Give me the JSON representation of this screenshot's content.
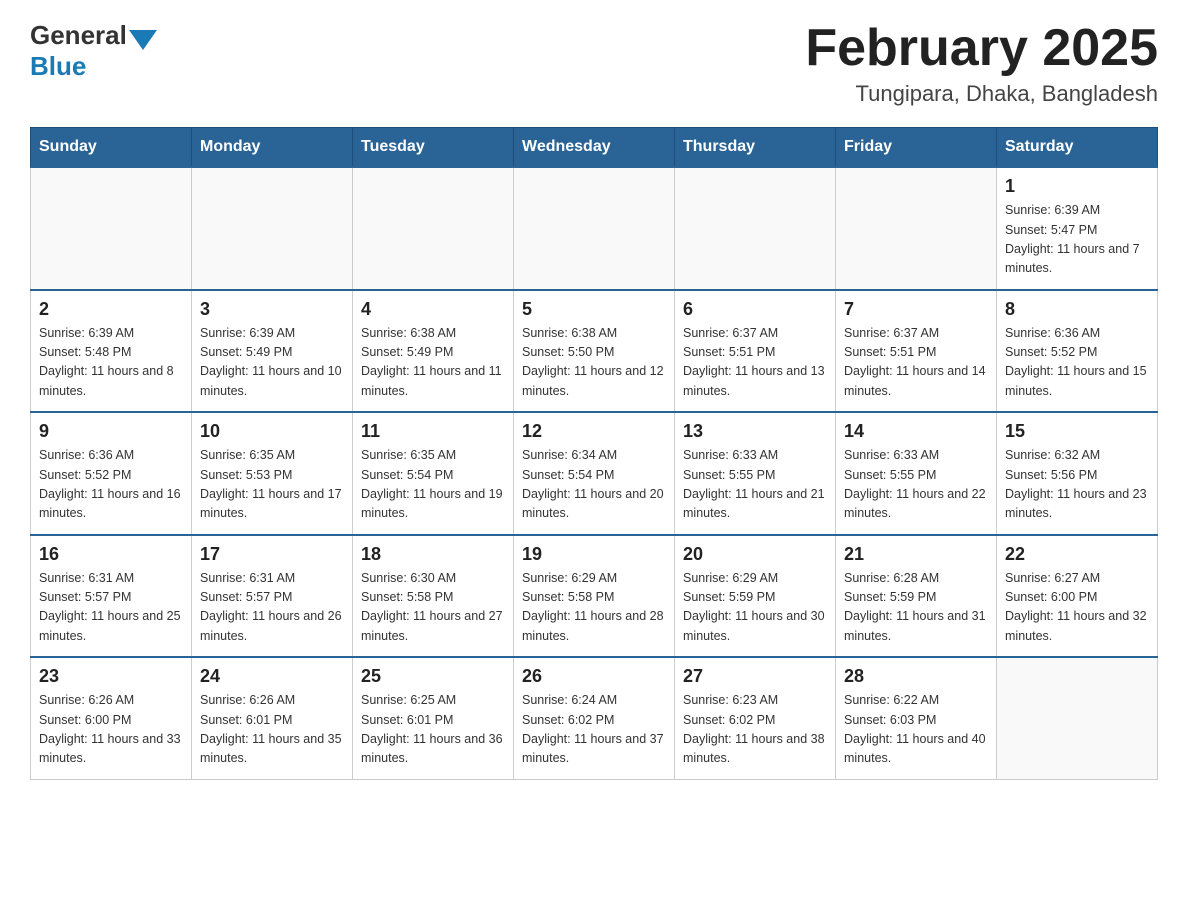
{
  "header": {
    "logo_general": "General",
    "logo_blue": "Blue",
    "title": "February 2025",
    "location": "Tungipara, Dhaka, Bangladesh"
  },
  "weekdays": [
    "Sunday",
    "Monday",
    "Tuesday",
    "Wednesday",
    "Thursday",
    "Friday",
    "Saturday"
  ],
  "weeks": [
    [
      {
        "day": "",
        "info": ""
      },
      {
        "day": "",
        "info": ""
      },
      {
        "day": "",
        "info": ""
      },
      {
        "day": "",
        "info": ""
      },
      {
        "day": "",
        "info": ""
      },
      {
        "day": "",
        "info": ""
      },
      {
        "day": "1",
        "info": "Sunrise: 6:39 AM\nSunset: 5:47 PM\nDaylight: 11 hours and 7 minutes."
      }
    ],
    [
      {
        "day": "2",
        "info": "Sunrise: 6:39 AM\nSunset: 5:48 PM\nDaylight: 11 hours and 8 minutes."
      },
      {
        "day": "3",
        "info": "Sunrise: 6:39 AM\nSunset: 5:49 PM\nDaylight: 11 hours and 10 minutes."
      },
      {
        "day": "4",
        "info": "Sunrise: 6:38 AM\nSunset: 5:49 PM\nDaylight: 11 hours and 11 minutes."
      },
      {
        "day": "5",
        "info": "Sunrise: 6:38 AM\nSunset: 5:50 PM\nDaylight: 11 hours and 12 minutes."
      },
      {
        "day": "6",
        "info": "Sunrise: 6:37 AM\nSunset: 5:51 PM\nDaylight: 11 hours and 13 minutes."
      },
      {
        "day": "7",
        "info": "Sunrise: 6:37 AM\nSunset: 5:51 PM\nDaylight: 11 hours and 14 minutes."
      },
      {
        "day": "8",
        "info": "Sunrise: 6:36 AM\nSunset: 5:52 PM\nDaylight: 11 hours and 15 minutes."
      }
    ],
    [
      {
        "day": "9",
        "info": "Sunrise: 6:36 AM\nSunset: 5:52 PM\nDaylight: 11 hours and 16 minutes."
      },
      {
        "day": "10",
        "info": "Sunrise: 6:35 AM\nSunset: 5:53 PM\nDaylight: 11 hours and 17 minutes."
      },
      {
        "day": "11",
        "info": "Sunrise: 6:35 AM\nSunset: 5:54 PM\nDaylight: 11 hours and 19 minutes."
      },
      {
        "day": "12",
        "info": "Sunrise: 6:34 AM\nSunset: 5:54 PM\nDaylight: 11 hours and 20 minutes."
      },
      {
        "day": "13",
        "info": "Sunrise: 6:33 AM\nSunset: 5:55 PM\nDaylight: 11 hours and 21 minutes."
      },
      {
        "day": "14",
        "info": "Sunrise: 6:33 AM\nSunset: 5:55 PM\nDaylight: 11 hours and 22 minutes."
      },
      {
        "day": "15",
        "info": "Sunrise: 6:32 AM\nSunset: 5:56 PM\nDaylight: 11 hours and 23 minutes."
      }
    ],
    [
      {
        "day": "16",
        "info": "Sunrise: 6:31 AM\nSunset: 5:57 PM\nDaylight: 11 hours and 25 minutes."
      },
      {
        "day": "17",
        "info": "Sunrise: 6:31 AM\nSunset: 5:57 PM\nDaylight: 11 hours and 26 minutes."
      },
      {
        "day": "18",
        "info": "Sunrise: 6:30 AM\nSunset: 5:58 PM\nDaylight: 11 hours and 27 minutes."
      },
      {
        "day": "19",
        "info": "Sunrise: 6:29 AM\nSunset: 5:58 PM\nDaylight: 11 hours and 28 minutes."
      },
      {
        "day": "20",
        "info": "Sunrise: 6:29 AM\nSunset: 5:59 PM\nDaylight: 11 hours and 30 minutes."
      },
      {
        "day": "21",
        "info": "Sunrise: 6:28 AM\nSunset: 5:59 PM\nDaylight: 11 hours and 31 minutes."
      },
      {
        "day": "22",
        "info": "Sunrise: 6:27 AM\nSunset: 6:00 PM\nDaylight: 11 hours and 32 minutes."
      }
    ],
    [
      {
        "day": "23",
        "info": "Sunrise: 6:26 AM\nSunset: 6:00 PM\nDaylight: 11 hours and 33 minutes."
      },
      {
        "day": "24",
        "info": "Sunrise: 6:26 AM\nSunset: 6:01 PM\nDaylight: 11 hours and 35 minutes."
      },
      {
        "day": "25",
        "info": "Sunrise: 6:25 AM\nSunset: 6:01 PM\nDaylight: 11 hours and 36 minutes."
      },
      {
        "day": "26",
        "info": "Sunrise: 6:24 AM\nSunset: 6:02 PM\nDaylight: 11 hours and 37 minutes."
      },
      {
        "day": "27",
        "info": "Sunrise: 6:23 AM\nSunset: 6:02 PM\nDaylight: 11 hours and 38 minutes."
      },
      {
        "day": "28",
        "info": "Sunrise: 6:22 AM\nSunset: 6:03 PM\nDaylight: 11 hours and 40 minutes."
      },
      {
        "day": "",
        "info": ""
      }
    ]
  ]
}
